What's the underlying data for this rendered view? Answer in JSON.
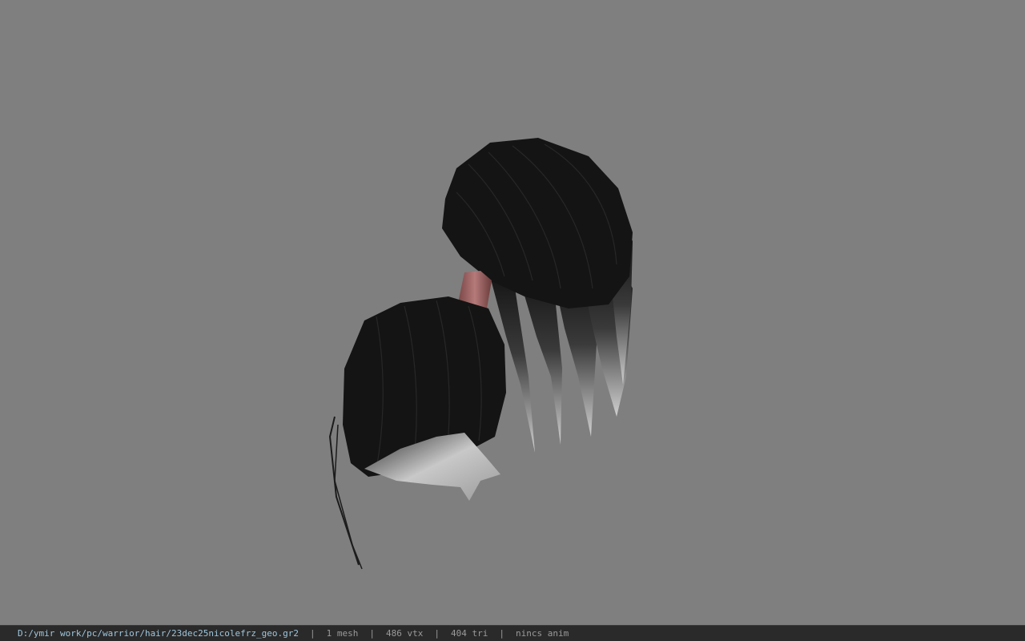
{
  "viewport": {
    "model_name": "hair-mesh-preview",
    "background_color": "#7f7f7f",
    "hair_color": "#141414",
    "hair_tip_color": "#bdbdbd",
    "tie_color": "#a46b6b"
  },
  "status_bar": {
    "file_path": "D:/ymir work/pc/warrior/hair/23dec25nicolefrz_geo.gr2",
    "separator": "|",
    "mesh_count": "1 mesh",
    "vertex_count": "486 vtx",
    "triangle_count": "404 tri",
    "animation": "nincs anim",
    "path_color": "#9fc6dc",
    "text_color": "#9a9a9a"
  }
}
